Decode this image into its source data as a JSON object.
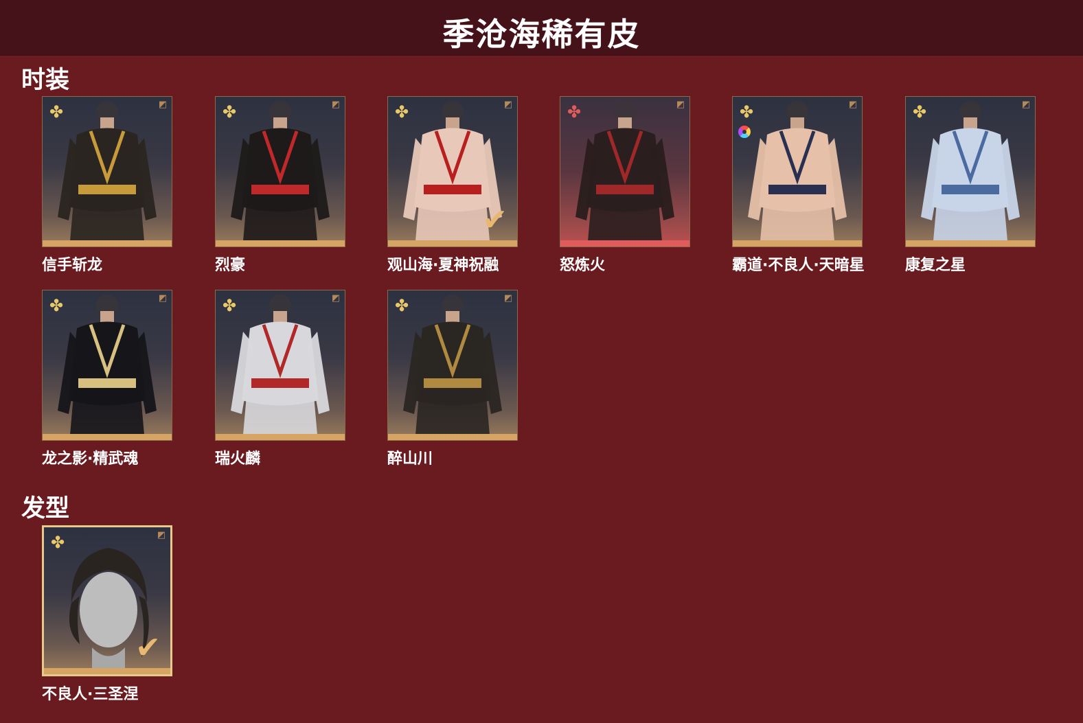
{
  "header": {
    "title": "季沧海稀有皮"
  },
  "sections": {
    "costumes": {
      "title": "时装",
      "items": [
        {
          "name": "信手斩龙",
          "rarity_icon": "gold-flower-icon",
          "outfit_color": "#2a2520",
          "accent": "#c79a3a",
          "equipped": false,
          "dye": false
        },
        {
          "name": "烈豪",
          "rarity_icon": "gold-flower-icon",
          "outfit_color": "#1e1a1a",
          "accent": "#c0282a",
          "equipped": false,
          "dye": false
        },
        {
          "name": "观山海·夏神祝融",
          "rarity_icon": "gold-flower-icon",
          "outfit_color": "#e8c8b8",
          "accent": "#b82020",
          "equipped": true,
          "dye": false
        },
        {
          "name": "怒炼火",
          "rarity_icon": "red-flower-icon",
          "outfit_color": "#2a1e1e",
          "accent": "#a02828",
          "equipped": false,
          "dye": false
        },
        {
          "name": "霸道·不良人·天暗星",
          "rarity_icon": "gold-flower-icon",
          "outfit_color": "#e6c0a8",
          "accent": "#2a3050",
          "equipped": false,
          "dye": true
        },
        {
          "name": "康复之星",
          "rarity_icon": "gold-flower-icon",
          "outfit_color": "#c8d4e8",
          "accent": "#4a6aa0",
          "equipped": false,
          "dye": false
        },
        {
          "name": "龙之影·精武魂",
          "rarity_icon": "gold-flower-icon",
          "outfit_color": "#15151a",
          "accent": "#d8c080",
          "equipped": false,
          "dye": false
        },
        {
          "name": "瑞火麟",
          "rarity_icon": "gold-flower-icon",
          "outfit_color": "#d8d8dc",
          "accent": "#b02828",
          "equipped": false,
          "dye": false
        },
        {
          "name": "醉山川",
          "rarity_icon": "gold-flower-icon",
          "outfit_color": "#2a2622",
          "accent": "#b08a40",
          "equipped": false,
          "dye": false
        }
      ]
    },
    "hairstyles": {
      "title": "发型",
      "items": [
        {
          "name": "不良人·三圣涅",
          "rarity_icon": "gold-flower-icon",
          "equipped": true
        }
      ]
    }
  },
  "glyphs": {
    "flower": "✤",
    "check": "✔",
    "corner": "◩"
  }
}
